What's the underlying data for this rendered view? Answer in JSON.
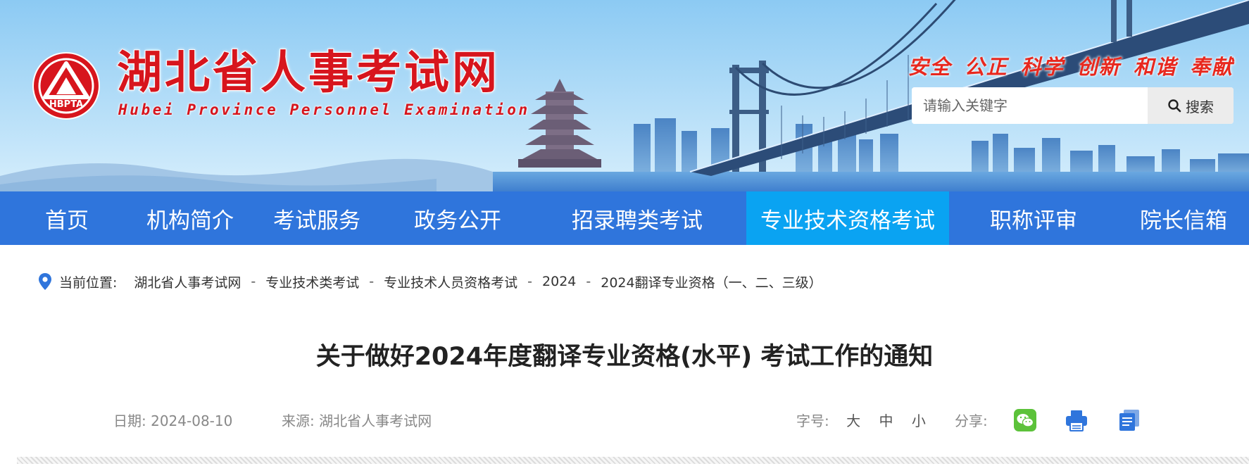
{
  "site": {
    "title_cn": "湖北省人事考试网",
    "title_en": "Hubei Province Personnel Examination",
    "logo_text": "HBPTA",
    "slogan": "安全 公正 科学 创新 和谐 奉献"
  },
  "search": {
    "placeholder": "请输入关键字",
    "button_label": "搜索"
  },
  "nav": {
    "items": [
      {
        "label": "首页"
      },
      {
        "label": "机构简介"
      },
      {
        "label": "考试服务"
      },
      {
        "label": "政务公开"
      },
      {
        "label": "招录聘类考试"
      },
      {
        "label": "专业技术资格考试",
        "active": true
      },
      {
        "label": "职称评审"
      },
      {
        "label": "院长信箱"
      }
    ]
  },
  "breadcrumb": {
    "label": "当前位置:",
    "items": [
      "湖北省人事考试网",
      "专业技术类考试",
      "专业技术人员资格考试",
      "2024",
      "2024翻译专业资格（一、二、三级）"
    ],
    "separator": "-"
  },
  "article": {
    "title": "关于做好2024年度翻译专业资格(水平) 考试工作的通知",
    "date_label": "日期:",
    "date": "2024-08-10",
    "source_label": "来源:",
    "source": "湖北省人事考试网",
    "font_size_label": "字号:",
    "font_sizes": [
      "大",
      "中",
      "小"
    ],
    "share_label": "分享:"
  },
  "icons": {
    "share": [
      "wechat-icon",
      "print-icon",
      "copy-icon"
    ],
    "breadcrumb": "location-pin-icon",
    "search": "search-icon"
  },
  "colors": {
    "nav_bg": "#2f75dc",
    "nav_active": "#0aa3f2",
    "logo_red": "#d7151d",
    "slogan_red": "#e8281e",
    "wechat_green": "#5cc23a",
    "icon_blue": "#2f75dc"
  }
}
